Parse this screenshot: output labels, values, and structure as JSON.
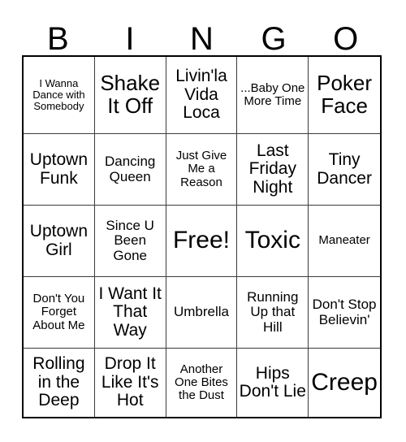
{
  "card": {
    "title": "BINGO",
    "header_letters": [
      "B",
      "I",
      "N",
      "G",
      "O"
    ],
    "free_space_label": "Free!",
    "colors": {
      "background": "#ffffff",
      "text": "#000000",
      "outer_border": "#000000",
      "inner_border": "#3b3b3b"
    },
    "grid_size": "5x5",
    "rows": [
      {
        "cells": [
          {
            "text": "I Wanna Dance with Somebody",
            "size": "fs-xs"
          },
          {
            "text": "Shake It Off",
            "size": "fs-xl"
          },
          {
            "text": "Livin'la Vida Loca",
            "size": "fs-lg"
          },
          {
            "text": "...Baby One More Time",
            "size": "fs-sm"
          },
          {
            "text": "Poker Face",
            "size": "fs-xl"
          }
        ]
      },
      {
        "cells": [
          {
            "text": "Uptown Funk",
            "size": "fs-lg"
          },
          {
            "text": "Dancing Queen",
            "size": "fs-md"
          },
          {
            "text": "Just Give Me a Reason",
            "size": "fs-sm"
          },
          {
            "text": "Last Friday Night",
            "size": "fs-lg"
          },
          {
            "text": "Tiny Dancer",
            "size": "fs-lg"
          }
        ]
      },
      {
        "cells": [
          {
            "text": "Uptown Girl",
            "size": "fs-lg"
          },
          {
            "text": "Since U Been Gone",
            "size": "fs-md"
          },
          {
            "text": "Free!",
            "size": "fs-xxl"
          },
          {
            "text": "Toxic",
            "size": "fs-xxl"
          },
          {
            "text": "Maneater",
            "size": "fs-sm"
          }
        ]
      },
      {
        "cells": [
          {
            "text": "Don't You Forget About Me",
            "size": "fs-sm"
          },
          {
            "text": "I Want It That Way",
            "size": "fs-lg"
          },
          {
            "text": "Umbrella",
            "size": "fs-md"
          },
          {
            "text": "Running Up that Hill",
            "size": "fs-md"
          },
          {
            "text": "Don't Stop Believin'",
            "size": "fs-md"
          }
        ]
      },
      {
        "cells": [
          {
            "text": "Rolling in the Deep",
            "size": "fs-lg"
          },
          {
            "text": "Drop It Like It's Hot",
            "size": "fs-lg"
          },
          {
            "text": "Another One Bites the Dust",
            "size": "fs-sm"
          },
          {
            "text": "Hips Don't Lie",
            "size": "fs-lg"
          },
          {
            "text": "Creep",
            "size": "fs-xxl"
          }
        ]
      }
    ]
  }
}
